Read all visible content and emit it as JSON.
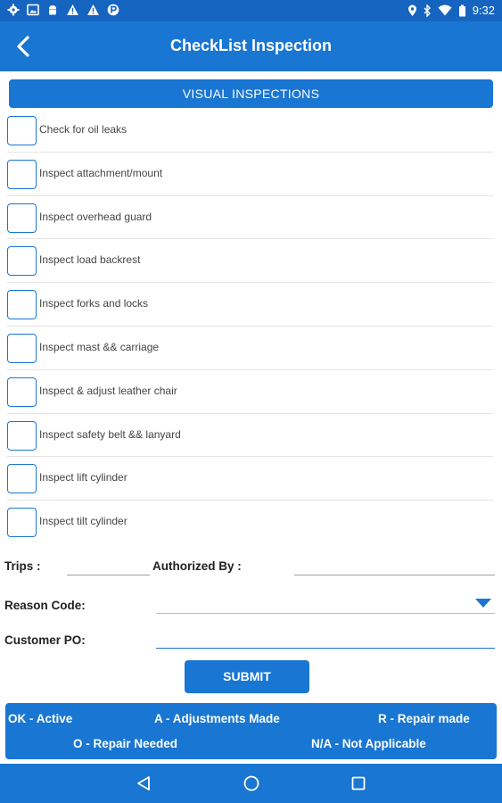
{
  "status_bar": {
    "time": "9:32",
    "left_icons": [
      "settings-icon",
      "image-icon",
      "android-icon",
      "warning-icon",
      "warning-icon",
      "parking-icon"
    ],
    "right_icons": [
      "location-icon",
      "bluetooth-icon",
      "wifi-icon",
      "battery-icon"
    ]
  },
  "header": {
    "title": "CheckList Inspection",
    "back_icon": "back-arrow-icon"
  },
  "section": {
    "title": "VISUAL INSPECTIONS"
  },
  "checklist": [
    {
      "label": "Check for oil leaks",
      "checked": false
    },
    {
      "label": "Inspect attachment/mount",
      "checked": false
    },
    {
      "label": "Inspect overhead guard",
      "checked": false
    },
    {
      "label": "Inspect load backrest",
      "checked": false
    },
    {
      "label": "Inspect forks and locks",
      "checked": false
    },
    {
      "label": "Inspect mast && carriage",
      "checked": false
    },
    {
      "label": "Inspect & adjust leather chair",
      "checked": false
    },
    {
      "label": "Inspect safety belt && lanyard",
      "checked": false
    },
    {
      "label": "Inspect lift cylinder",
      "checked": false
    },
    {
      "label": "Inspect tilt cylinder",
      "checked": false
    }
  ],
  "form": {
    "trips_label": "Trips :",
    "trips_value": "",
    "authorized_label": "Authorized By :",
    "authorized_value": "",
    "reason_label": "Reason Code:",
    "reason_value": "",
    "po_label": "Customer PO:",
    "po_value": ""
  },
  "submit_label": "SUBMIT",
  "legend": {
    "ok": "OK - Active",
    "a": "A - Adjustments Made",
    "r": "R - Repair made",
    "o": "O - Repair Needed",
    "na": "N/A - Not Applicable"
  },
  "colors": {
    "primary": "#1976D2",
    "status_bar": "#1565C0",
    "text": "#222222"
  }
}
